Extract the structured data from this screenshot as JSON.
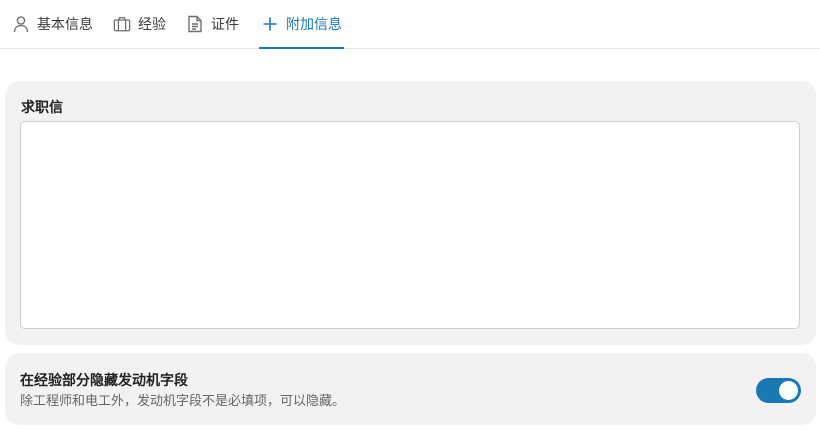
{
  "tabs": [
    {
      "label": "基本信息",
      "icon": "person-icon",
      "active": false
    },
    {
      "label": "经验",
      "icon": "briefcase-icon",
      "active": false
    },
    {
      "label": "证件",
      "icon": "document-icon",
      "active": false
    },
    {
      "label": "附加信息",
      "icon": "plus-icon",
      "active": true
    }
  ],
  "cover_letter": {
    "label": "求职信",
    "value": ""
  },
  "hide_motivation": {
    "title": "在经验部分隐藏发动机字段",
    "description": "除工程师和电工外，发动机字段不是必填项，可以隐藏。",
    "enabled": true
  },
  "colors": {
    "accent": "#1a78b4",
    "card_bg": "#f3f1f2"
  }
}
